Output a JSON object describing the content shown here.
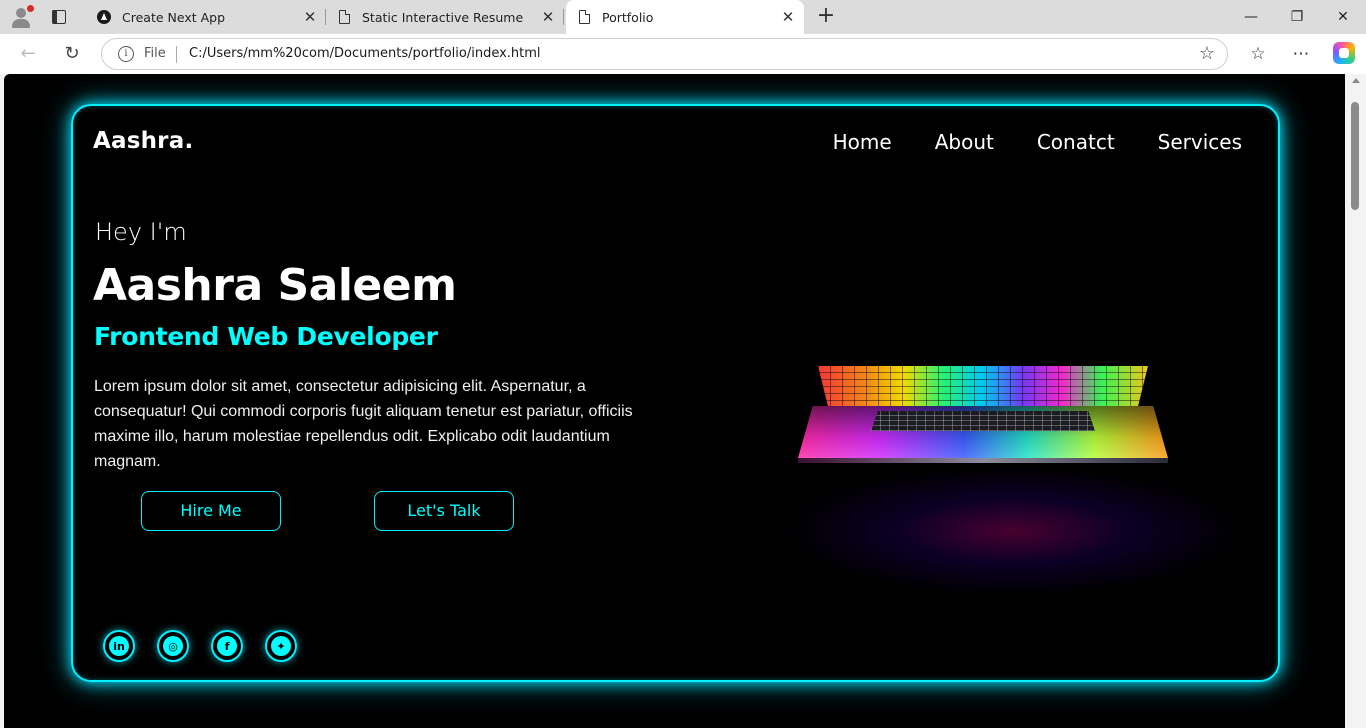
{
  "browser": {
    "tabs": [
      {
        "title": "Create Next App",
        "icon": "nextjs-icon"
      },
      {
        "title": "Static Interactive Resume",
        "icon": "page-icon"
      },
      {
        "title": "Portfolio",
        "icon": "page-icon",
        "active": true
      }
    ],
    "address": {
      "security_label": "File",
      "url": "C:/Users/mm%20com/Documents/portfolio/index.html"
    }
  },
  "site": {
    "logo": "Aashra.",
    "nav": [
      "Home",
      "About",
      "Conatct",
      "Services"
    ],
    "hero": {
      "greeting": "Hey I'm",
      "name": "Aashra Saleem",
      "role": "Frontend Web Developer",
      "description": "Lorem ipsum dolor sit amet, consectetur adipisicing elit. Aspernatur, a consequatur! Qui commodi corporis fugit aliquam tenetur est pariatur, officiis maxime illo, harum molestiae repellendus odit. Explicabo odit laudantium magnam.",
      "buttons": {
        "hire": "Hire Me",
        "talk": "Let's Talk"
      }
    },
    "socials": [
      {
        "name": "linkedin-icon",
        "glyph": "in"
      },
      {
        "name": "instagram-icon",
        "glyph": "◎"
      },
      {
        "name": "facebook-icon",
        "glyph": "f"
      },
      {
        "name": "twitter-icon",
        "glyph": "✦"
      }
    ],
    "colors": {
      "accent": "#00ffff",
      "background": "#000000",
      "text": "#ffffff"
    }
  }
}
